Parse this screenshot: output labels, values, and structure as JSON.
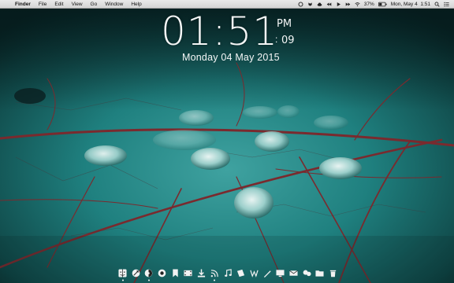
{
  "menubar": {
    "apple_glyph": "",
    "menus": [
      "Finder",
      "File",
      "Edit",
      "View",
      "Go",
      "Window",
      "Help"
    ],
    "tray_icons": [
      "circle-icon",
      "dropbox-icon",
      "cloud-icon",
      "rewind-icon",
      "play-icon",
      "forward-icon",
      "wifi-icon"
    ],
    "battery": "37%",
    "datetime": "Mon, May 4  1:51"
  },
  "clock": {
    "time": "01:51",
    "ampm": "PM",
    "sec_sep": ":",
    "seconds": "09",
    "date": "Monday 04 May 2015"
  },
  "dock": {
    "items": [
      "finder-icon",
      "launchpad-icon",
      "browser-icon",
      "camera-icon",
      "bookmark-icon",
      "movie-icon",
      "download-icon",
      "feed-icon",
      "music-icon",
      "notes-icon",
      "dictionary-icon",
      "pen-icon",
      "display-icon",
      "mail-icon",
      "share-icon",
      "folder-icon",
      "trash-icon"
    ]
  },
  "colors": {
    "wallpaper_teal": "#1f7f7f",
    "vein": "#7a2a2e",
    "text": "#f4f6f6"
  }
}
